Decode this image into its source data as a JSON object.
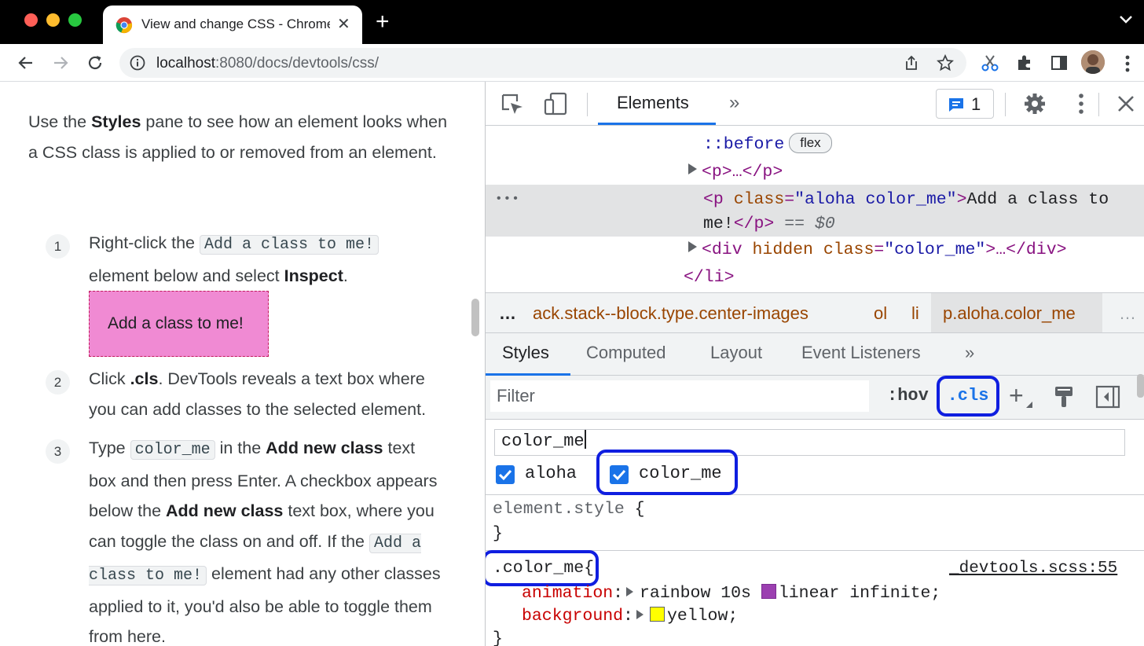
{
  "browser": {
    "tab_title": "View and change CSS - Chrome Developers",
    "url_host": "localhost",
    "url_rest": ":8080/docs/devtools/css/"
  },
  "doc": {
    "intro_pre": "Use the ",
    "intro_bold": "Styles",
    "intro_post": " pane to see how an element looks when a CSS class is applied to or removed from an element.",
    "steps": [
      {
        "num": "1",
        "a": "Right-click the ",
        "code1": "Add a class to me!",
        "b": " element below and select ",
        "bold1": "Inspect",
        "c": "."
      },
      {
        "num": "2",
        "a": "Click ",
        "bold1": ".cls",
        "b": ". DevTools reveals a text box where you can add classes to the selected element."
      },
      {
        "num": "3",
        "a": "Type ",
        "code1": "color_me",
        "b": " in the ",
        "bold1": "Add new class",
        "c": " text box and then press Enter. A checkbox appears below the ",
        "bold2": "Add new class",
        "d": " text box, where you can toggle the class on and off. If the ",
        "code2": "Add a class to me!",
        "e": " element had any other classes applied to it, you'd also be able to toggle them from here."
      }
    ],
    "demo_box": "Add a class to me!"
  },
  "devtools": {
    "main_tab": "Elements",
    "more_tabs": "»",
    "issues_count": "1",
    "dom": {
      "before": "::before",
      "flex_badge": "flex",
      "p_collapsed": "<p>…</p>",
      "sel_open_tag": "<p ",
      "sel_attr_name": "class",
      "sel_attr_val": "\"aloha color_me\"",
      "sel_close": ">",
      "sel_text_1": "Add a class to",
      "sel_text_2": "me!",
      "sel_end_tag": "</p>",
      "sel_eq": " == ",
      "sel_dollar": "$0",
      "div_open": "<div ",
      "div_hidden": "hidden",
      "div_class": "class",
      "div_val": "\"color_me\"",
      "div_rest": ">…</div>",
      "li_close": "</li>",
      "ellipsis": "•••"
    },
    "breadcrumbs": {
      "lead": "…",
      "items": [
        "ack.stack--block.type.center-images",
        "ol",
        "li",
        "p.aloha.color_me"
      ],
      "trail": "…"
    },
    "sub_tabs": [
      "Styles",
      "Computed",
      "Layout",
      "Event Listeners",
      "»"
    ],
    "filter_placeholder": "Filter",
    "hov_label": ":hov",
    "cls_label": ".cls",
    "plus_label": "+",
    "new_class_value": "color_me",
    "classes": [
      {
        "name": "aloha",
        "checked": true
      },
      {
        "name": "color_me",
        "checked": true
      }
    ],
    "rules": {
      "element_style": "element.style",
      "open_brace": " {",
      "close_brace": "}",
      "selector": ".color_me",
      "selector_brace": "{",
      "source": "_devtools.scss:55",
      "prop1_name": "animation",
      "prop1_colon": ":",
      "prop1_val_a": "rainbow 10s",
      "prop1_val_b": "linear infinite;",
      "prop2_name": "background",
      "prop2_colon": ":",
      "prop2_val": "yellow;"
    }
  },
  "colors": {
    "highlight_outline": "#0f1ee0",
    "demo_box_bg": "#f08ad3",
    "selected_row": "#e2e3e4"
  }
}
